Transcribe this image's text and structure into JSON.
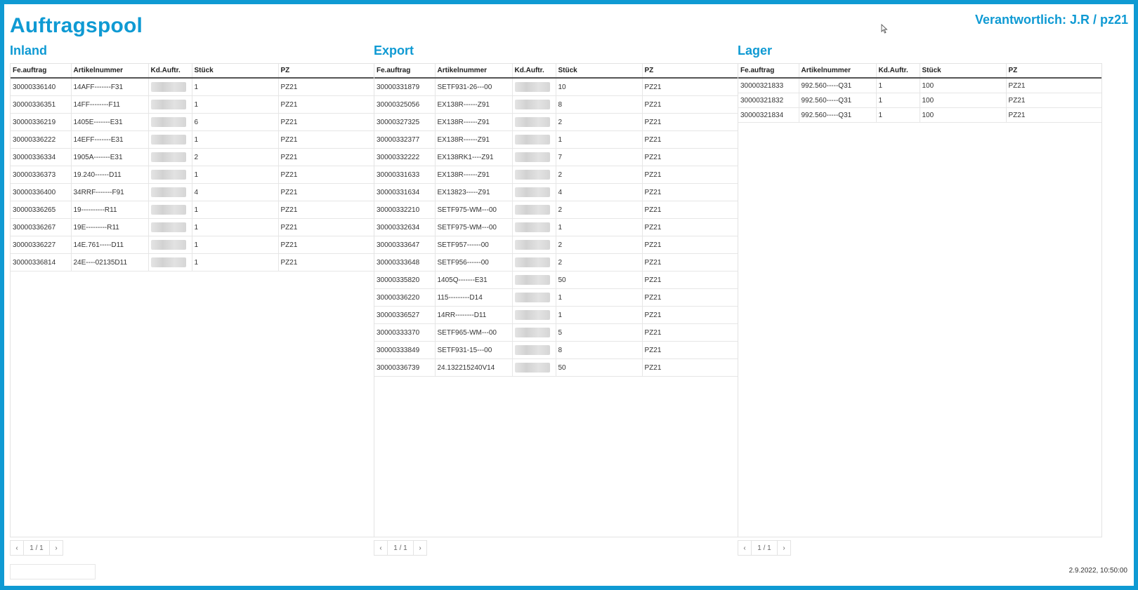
{
  "header": {
    "title": "Auftragspool",
    "responsible": "Verantwortlich: J.R / pz21"
  },
  "columns": [
    "Fe.auftrag",
    "Artikelnummer",
    "Kd.Auftr.",
    "Stück",
    "PZ"
  ],
  "panels": [
    {
      "title": "Inland",
      "pager": {
        "prev": "‹",
        "info": "1 / 1",
        "next": "›"
      },
      "rows": [
        [
          "30000336140",
          "14AFF-------F31",
          "",
          "1",
          "PZ21"
        ],
        [
          "30000336351",
          "14FF--------F11",
          "",
          "1",
          "PZ21"
        ],
        [
          "30000336219",
          "1405E-------E31",
          "",
          "6",
          "PZ21"
        ],
        [
          "30000336222",
          "14EFF-------E31",
          "",
          "1",
          "PZ21"
        ],
        [
          "30000336334",
          "1905A-------E31",
          "",
          "2",
          "PZ21"
        ],
        [
          "30000336373",
          "19.240------D11",
          "",
          "1",
          "PZ21"
        ],
        [
          "30000336400",
          "34RRF-------F91",
          "",
          "4",
          "PZ21"
        ],
        [
          "30000336265",
          "19----------R11",
          "",
          "1",
          "PZ21"
        ],
        [
          "30000336267",
          "19E---------R11",
          "",
          "1",
          "PZ21"
        ],
        [
          "30000336227",
          "14E.761-----D11",
          "",
          "1",
          "PZ21"
        ],
        [
          "30000336814",
          "24E----02135D11",
          "",
          "1",
          "PZ21"
        ]
      ]
    },
    {
      "title": "Export",
      "pager": {
        "prev": "‹",
        "info": "1 / 1",
        "next": "›"
      },
      "rows": [
        [
          "30000331879",
          "SETF931-26---00",
          "",
          "10",
          "PZ21"
        ],
        [
          "30000325056",
          "EX138R------Z91",
          "",
          "8",
          "PZ21"
        ],
        [
          "30000327325",
          "EX138R------Z91",
          "",
          "2",
          "PZ21"
        ],
        [
          "30000332377",
          "EX138R------Z91",
          "",
          "1",
          "PZ21"
        ],
        [
          "30000332222",
          "EX138RK1----Z91",
          "",
          "7",
          "PZ21"
        ],
        [
          "30000331633",
          "EX138R------Z91",
          "",
          "2",
          "PZ21"
        ],
        [
          "30000331634",
          "EX13823-----Z91",
          "",
          "4",
          "PZ21"
        ],
        [
          "30000332210",
          "SETF975-WM---00",
          "",
          "2",
          "PZ21"
        ],
        [
          "30000332634",
          "SETF975-WM---00",
          "",
          "1",
          "PZ21"
        ],
        [
          "30000333647",
          "SETF957------00",
          "",
          "2",
          "PZ21"
        ],
        [
          "30000333648",
          "SETF956------00",
          "",
          "2",
          "PZ21"
        ],
        [
          "30000335820",
          "1405Q-------E31",
          "",
          "50",
          "PZ21"
        ],
        [
          "30000336220",
          "115---------D14",
          "",
          "1",
          "PZ21"
        ],
        [
          "30000336527",
          "14RR--------D11",
          "",
          "1",
          "PZ21"
        ],
        [
          "30000333370",
          "SETF965-WM---00",
          "",
          "5",
          "PZ21"
        ],
        [
          "30000333849",
          "SETF931-15---00",
          "",
          "8",
          "PZ21"
        ],
        [
          "30000336739",
          "24.132215240V14",
          "",
          "50",
          "PZ21"
        ]
      ]
    },
    {
      "title": "Lager",
      "pager": {
        "prev": "‹",
        "info": "1 / 1",
        "next": "›"
      },
      "rows": [
        [
          "30000321833",
          "992.560-----Q31",
          "1",
          "100",
          "PZ21"
        ],
        [
          "30000321832",
          "992.560-----Q31",
          "1",
          "100",
          "PZ21"
        ],
        [
          "30000321834",
          "992.560-----Q31",
          "1",
          "100",
          "PZ21"
        ]
      ]
    }
  ],
  "footer": {
    "timestamp": "2.9.2022, 10:50:00"
  },
  "colors": {
    "accent": "#0f9ad3"
  }
}
